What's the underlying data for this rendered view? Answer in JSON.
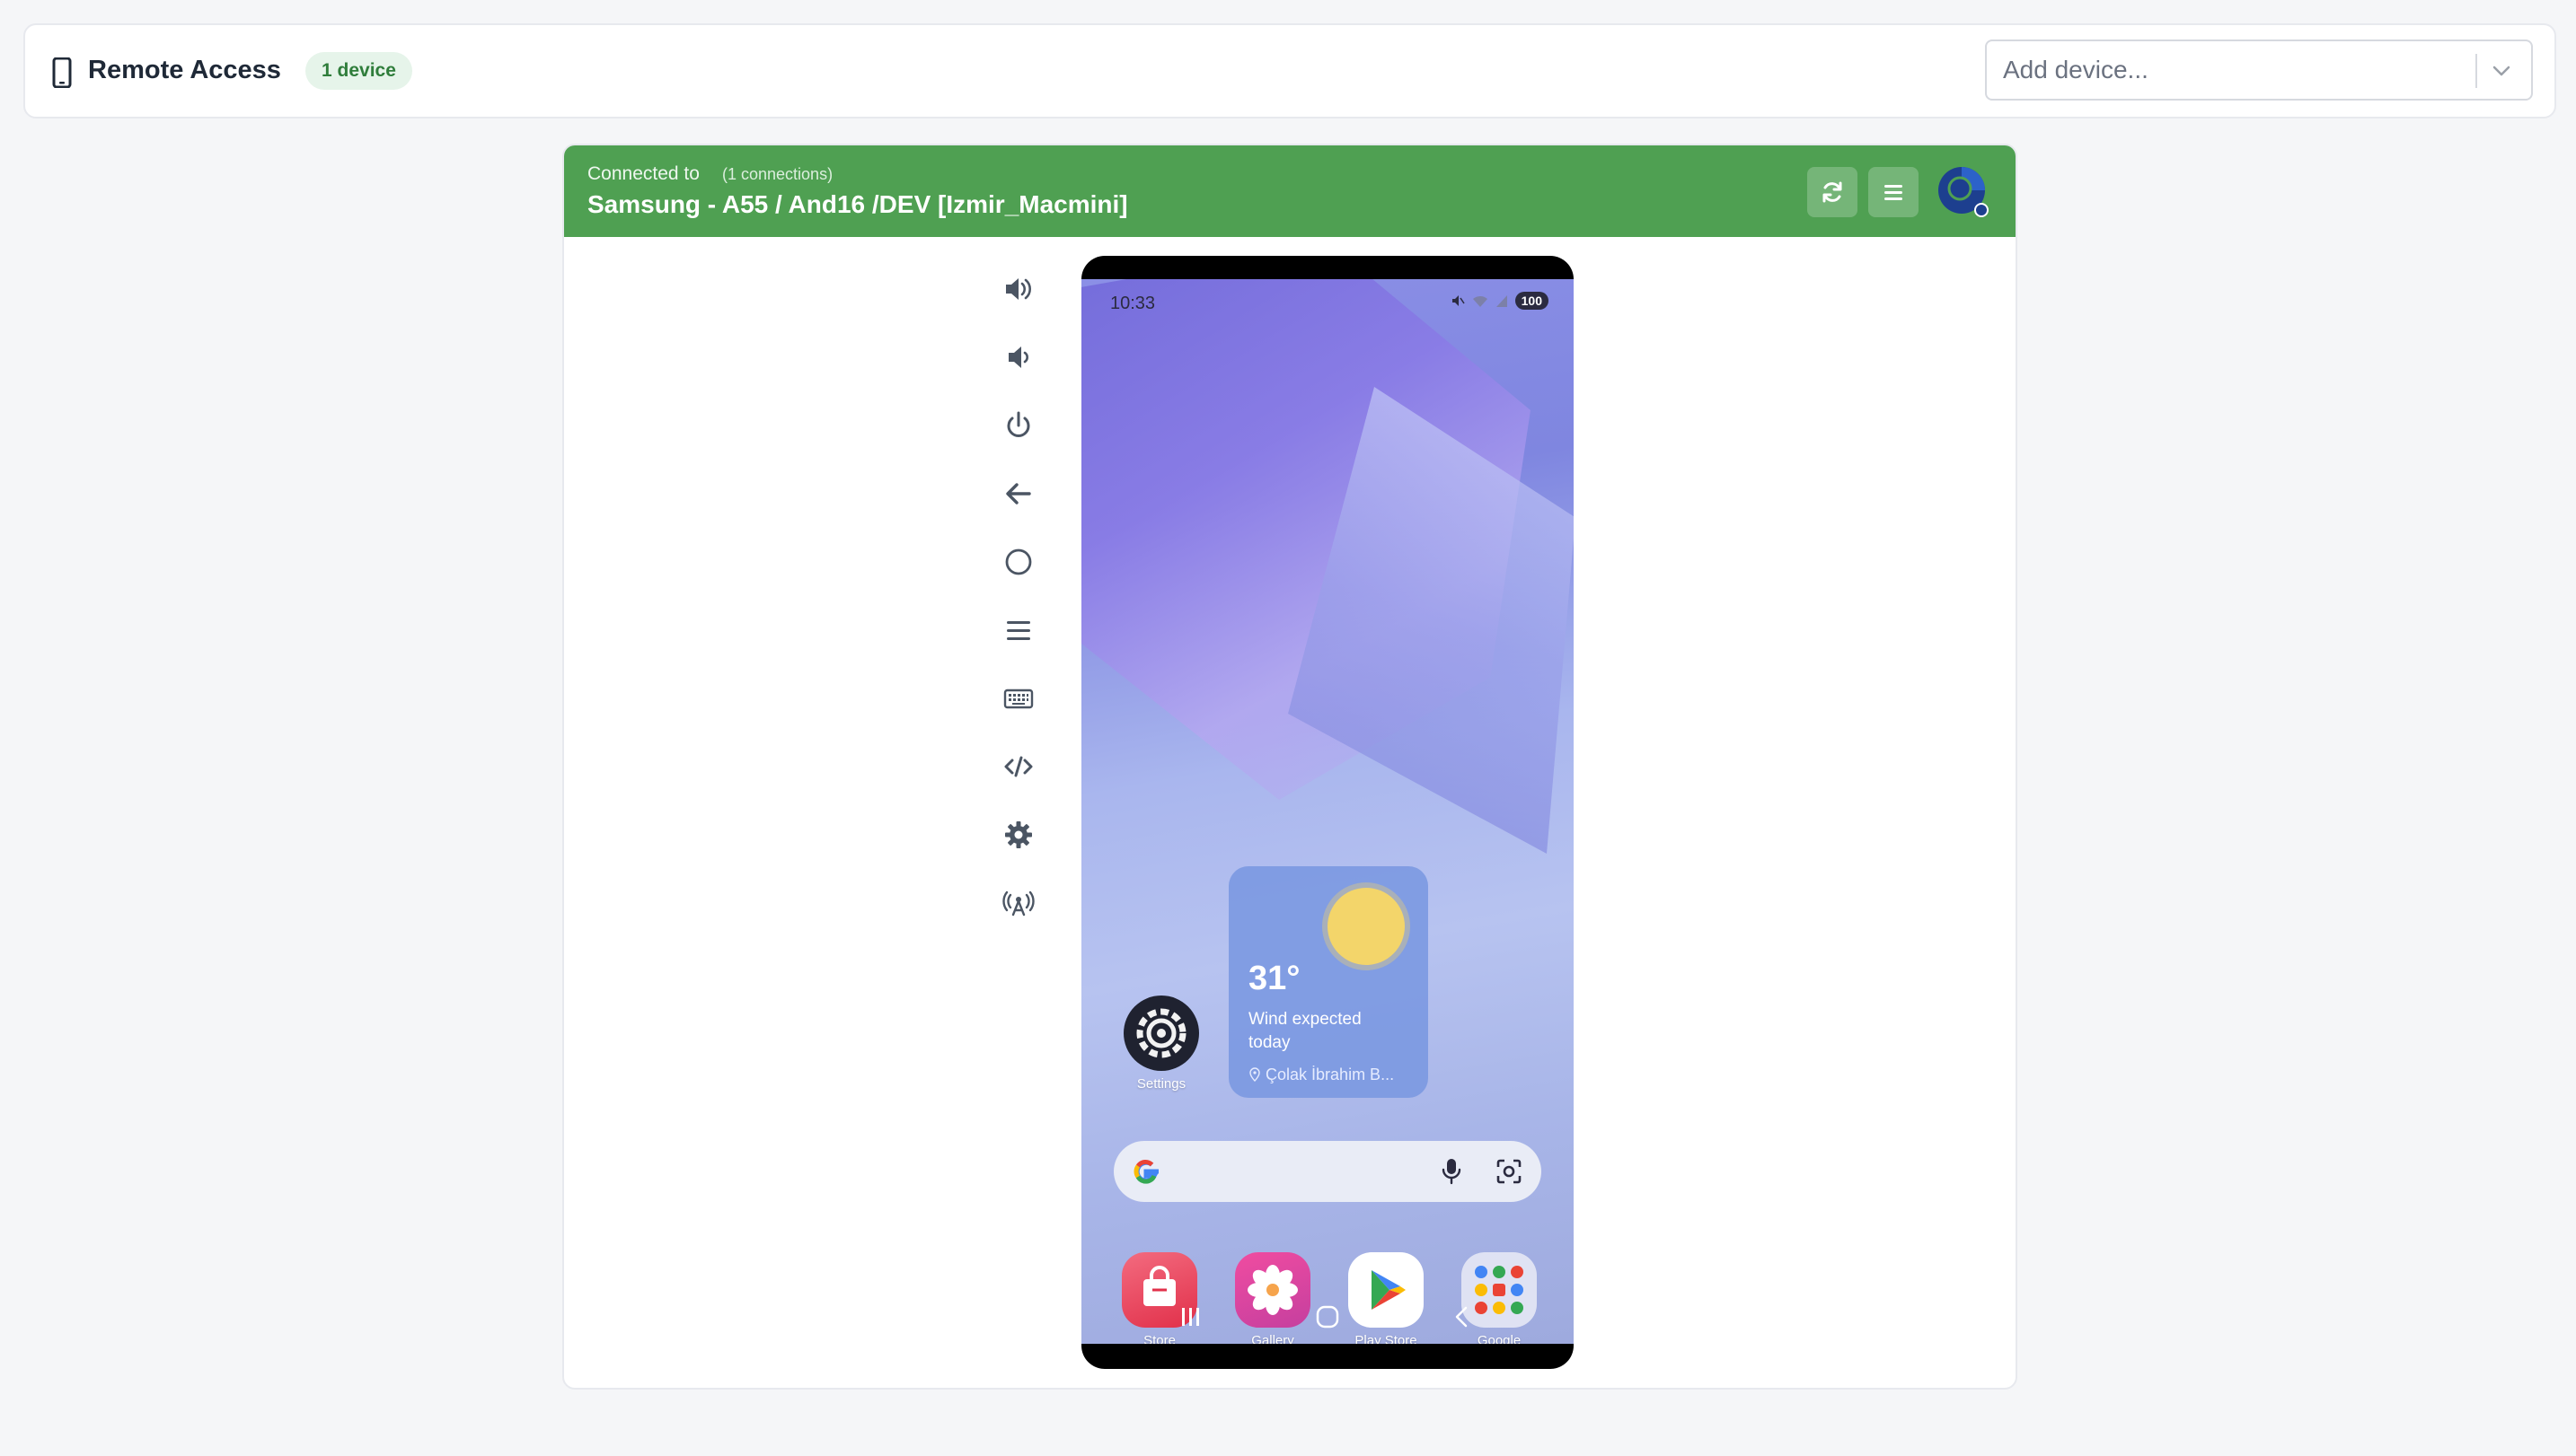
{
  "header": {
    "title": "Remote Access",
    "badge": "1 device",
    "device_select": {
      "placeholder": "Add device..."
    }
  },
  "session": {
    "connected_label": "Connected to",
    "connections": "(1 connections)",
    "device_name": "Samsung - A55 / And16 /DEV [Izmir_Macmini]"
  },
  "toolbar": {
    "items": [
      "volume-up",
      "volume-down",
      "power",
      "back",
      "home",
      "menu",
      "keyboard",
      "developer-code",
      "settings",
      "broadcast"
    ]
  },
  "phone": {
    "status_time": "10:33",
    "battery": "100",
    "weather": {
      "temp": "31°",
      "desc": "Wind expected today",
      "location": "Çolak İbrahim B..."
    },
    "apps": {
      "settings": "Settings",
      "store": "Store",
      "gallery": "Gallery",
      "play_store": "Play Store",
      "google": "Google"
    }
  },
  "colors": {
    "header_green": "#4fa052",
    "badge_bg": "#e6f4ea",
    "badge_text": "#2f7d3b"
  }
}
